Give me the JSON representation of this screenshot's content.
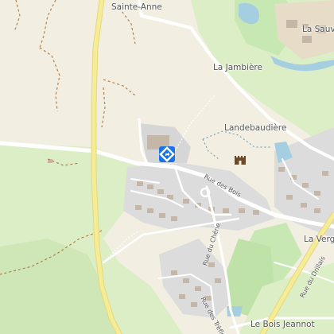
{
  "map": {
    "colors": {
      "background": "#f2efe2",
      "grass": "#dceec5",
      "park": "#c8e8b3",
      "residential": "#dcdcdc",
      "buildings": "#c4b7a8",
      "water": "#a5cfe0",
      "road": "#ffffff",
      "major_road": "#f5ec98",
      "path": "#b08050",
      "poi_blue": "#1a73e8"
    },
    "places": [
      {
        "id": "sainte-anne",
        "name": "Sainte-Anne"
      },
      {
        "id": "la-sauv",
        "name": "La Sauv"
      },
      {
        "id": "la-jambiere",
        "name": "La Jambière"
      },
      {
        "id": "landebaudiere",
        "name": "Landebaudière"
      },
      {
        "id": "la-verge",
        "name": "La Verge"
      },
      {
        "id": "le-bois-jeannot",
        "name": "Le Bois Jeannot"
      }
    ],
    "roads": [
      {
        "id": "rue-des-bois",
        "name": "Rue des Bois"
      },
      {
        "id": "rue-du-chene",
        "name": "Rue du Chêne"
      },
      {
        "id": "rue-des-trefles",
        "name": "Rue des Trèfles"
      },
      {
        "id": "rue-du-drillais",
        "name": "Rue du Drillais"
      }
    ],
    "markers": [
      {
        "id": "directions",
        "icon": "directions-icon"
      },
      {
        "id": "castle",
        "icon": "castle-icon"
      }
    ]
  }
}
